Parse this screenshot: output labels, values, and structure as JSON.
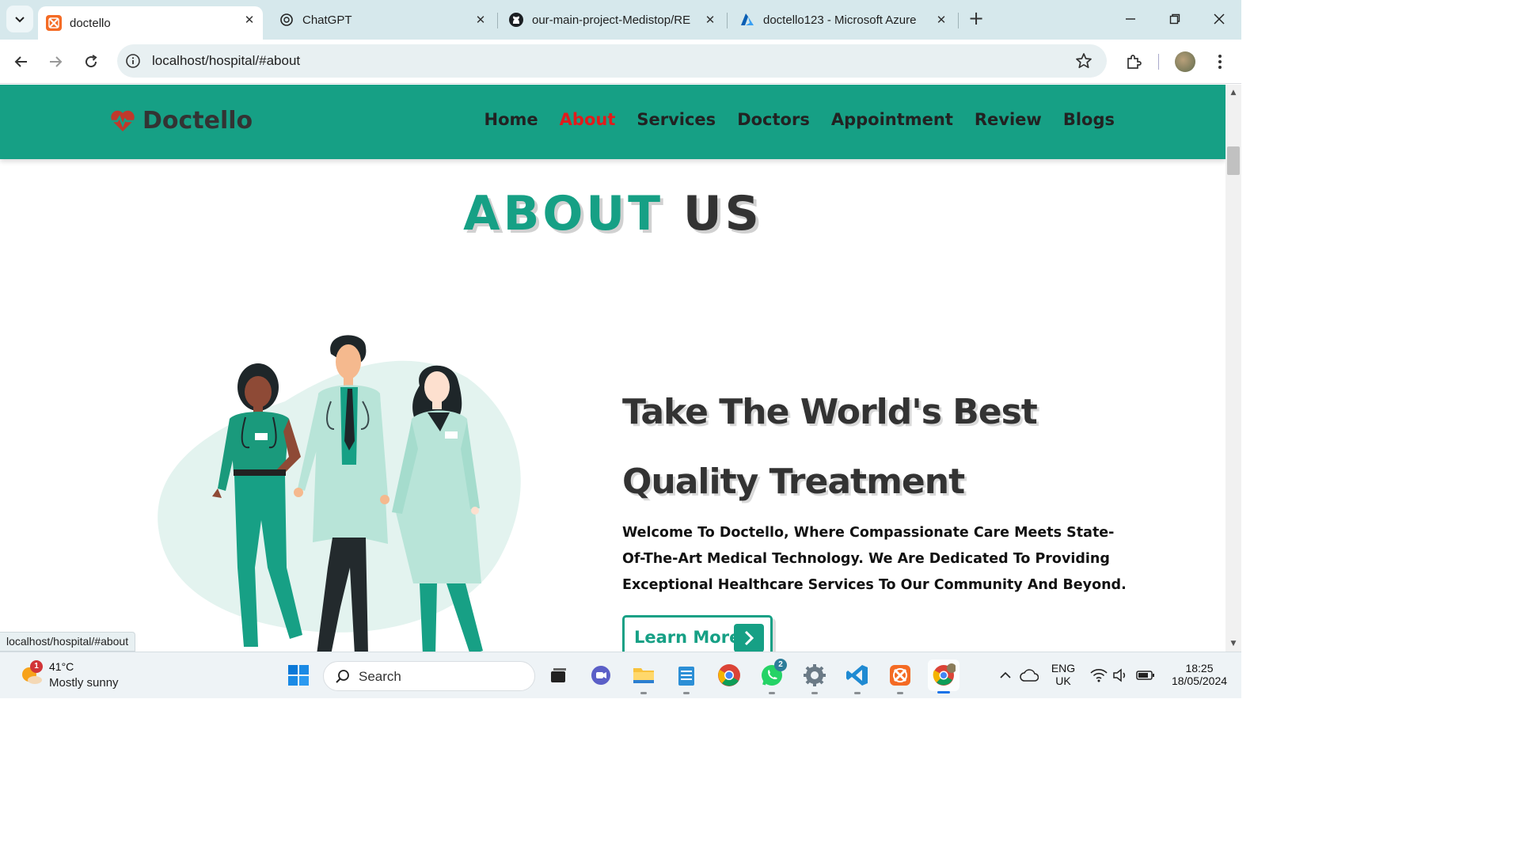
{
  "browser": {
    "tabs": [
      {
        "title": "doctello",
        "icon": "xampp-icon",
        "active": true
      },
      {
        "title": "ChatGPT",
        "icon": "chatgpt-icon",
        "active": false
      },
      {
        "title": "our-main-project-Medistop/RE",
        "icon": "github-icon",
        "active": false
      },
      {
        "title": "doctello123 - Microsoft Azure",
        "icon": "azure-icon",
        "active": false
      }
    ],
    "url": "localhost/hospital/#about",
    "status_url": "localhost/hospital/#about"
  },
  "site": {
    "logo_text": "Doctello",
    "nav": [
      {
        "label": "Home",
        "active": false
      },
      {
        "label": "About",
        "active": true
      },
      {
        "label": "Services",
        "active": false
      },
      {
        "label": "Doctors",
        "active": false
      },
      {
        "label": "Appointment",
        "active": false
      },
      {
        "label": "Review",
        "active": false
      },
      {
        "label": "Blogs",
        "active": false
      }
    ],
    "heading_accent": "ABOUT",
    "heading_rest": "US",
    "about_title_line1": "Take The World's Best",
    "about_title_line2": "Quality Treatment",
    "about_text": "Welcome To Doctello, Where Compassionate Care Meets State-Of-The-Art Medical Technology. We Are Dedicated To Providing Exceptional Healthcare Services To Our Community And Beyond.",
    "learn_more": "Learn More",
    "colors": {
      "brand": "#16a085",
      "active_nav": "#e31b1b",
      "text_dark": "#333333"
    }
  },
  "taskbar": {
    "weather_temp": "41°C",
    "weather_cond": "Mostly sunny",
    "weather_badge": "1",
    "search_placeholder": "Search",
    "whatsapp_badge": "2",
    "lang_1": "ENG",
    "lang_2": "UK",
    "time": "18:25",
    "date": "18/05/2024"
  }
}
